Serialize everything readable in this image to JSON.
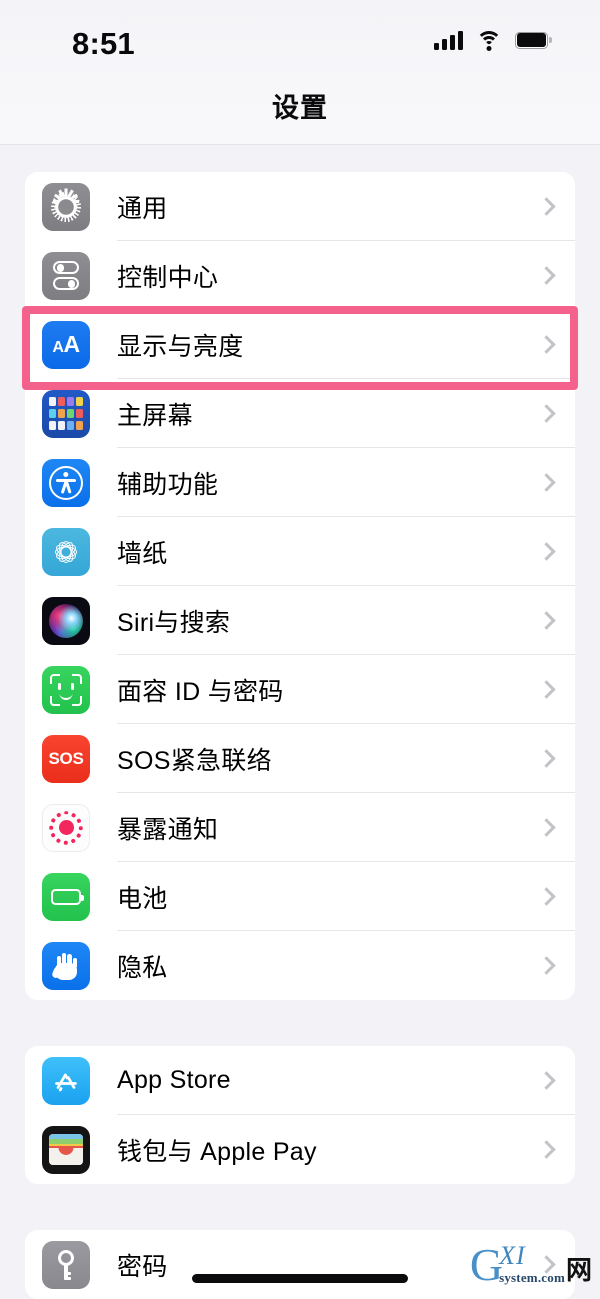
{
  "status_bar": {
    "time": "8:51",
    "signal_icon": "cellular-signal-icon",
    "wifi_icon": "wifi-icon",
    "battery_icon": "battery-full-icon"
  },
  "nav": {
    "title": "设置"
  },
  "highlight": {
    "color": "#f4628c",
    "target_row": "显示与亮度"
  },
  "groups": [
    {
      "rows": [
        {
          "label": "通用",
          "icon": "gear-icon",
          "icon_color": "#8e8e93"
        },
        {
          "label": "控制中心",
          "icon": "toggles-icon",
          "icon_color": "#8e8e93"
        },
        {
          "label": "显示与亮度",
          "icon": "aa-text-icon",
          "icon_color": "#0a6ae8"
        },
        {
          "label": "主屏幕",
          "icon": "home-grid-icon",
          "icon_color": "#1b49a8"
        },
        {
          "label": "辅助功能",
          "icon": "accessibility-icon",
          "icon_color": "#0a70ea"
        },
        {
          "label": "墙纸",
          "icon": "wallpaper-flower-icon",
          "icon_color": "#35a6d6"
        },
        {
          "label": "Siri与搜索",
          "icon": "siri-orb-icon",
          "icon_color": "#0e1030"
        },
        {
          "label": "面容 ID 与密码",
          "icon": "face-id-icon",
          "icon_color": "#22c24c"
        },
        {
          "label": "SOS紧急联络",
          "icon": "sos-icon",
          "icon_color": "#ea2f1c"
        },
        {
          "label": "暴露通知",
          "icon": "exposure-dots-icon",
          "icon_color": "#f4265e"
        },
        {
          "label": "电池",
          "icon": "battery-icon",
          "icon_color": "#23c24d"
        },
        {
          "label": "隐私",
          "icon": "privacy-hand-icon",
          "icon_color": "#0a70ea"
        }
      ]
    },
    {
      "rows": [
        {
          "label": "App Store",
          "icon": "app-store-icon",
          "icon_color": "#1aa2f0"
        },
        {
          "label": "钱包与 Apple Pay",
          "icon": "wallet-icon",
          "icon_color": "#141414"
        }
      ]
    },
    {
      "rows": [
        {
          "label": "密码",
          "icon": "key-icon",
          "icon_color": "#88888e"
        }
      ]
    }
  ],
  "chevron": "chevron-right-icon",
  "home_indicator": "home-indicator",
  "watermark": {
    "g": "G",
    "xi": "XI",
    "net": "网",
    "system": "system.com"
  }
}
